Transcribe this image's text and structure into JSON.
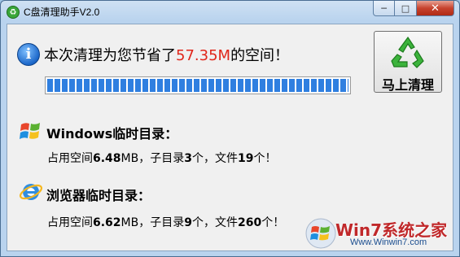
{
  "window": {
    "title": "C盘清理助手V2.0",
    "controls": {
      "minimize": "─",
      "maximize": "□",
      "close": "✕"
    }
  },
  "summary": {
    "prefix": "本次清理为您节省了",
    "amount": "57.35M",
    "suffix": "的空间！",
    "progress_percent": 100
  },
  "clean_button": {
    "label": "马上清理"
  },
  "sections": [
    {
      "title": "Windows临时目录：",
      "icon": "windows-flag-icon",
      "detail": {
        "size_prefix": "占用空间",
        "size": "6.48",
        "size_unit": "MB，子目录",
        "dirs": "3",
        "dirs_unit": "个，文件",
        "files": "19",
        "files_unit": "个！"
      }
    },
    {
      "title": "浏览器临时目录：",
      "icon": "internet-explorer-icon",
      "detail": {
        "size_prefix": "占用空间",
        "size": "6.62",
        "size_unit": "MB，子目录",
        "dirs": "9",
        "dirs_unit": "个，文件",
        "files": "260",
        "files_unit": "个！"
      }
    }
  ],
  "watermark": {
    "logo": "Win7系统之家",
    "url": "Www.Winwin7.com"
  },
  "colors": {
    "amount": "#e0261a",
    "progress": "#2f7fe0",
    "title_bar": "#b9d3ee"
  }
}
